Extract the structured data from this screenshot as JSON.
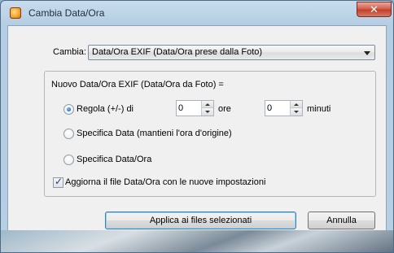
{
  "window": {
    "title": "Cambia Data/Ora",
    "close_glyph": "✕"
  },
  "change": {
    "label": "Cambia:",
    "selected": "Data/Ora EXIF (Data/Ora prese dalla Foto)"
  },
  "group": {
    "header": "Nuovo Data/Ora EXIF (Data/Ora da Foto) ="
  },
  "options": {
    "adjust": {
      "label": "Regola (+/-) di",
      "checked": true
    },
    "specify_date": {
      "label": "Specifica Data (mantieni l'ora d'origine)",
      "checked": false
    },
    "specify_datetime": {
      "label": "Specifica Data/Ora",
      "checked": false
    }
  },
  "adjust_hours": {
    "value": "0",
    "unit": "ore"
  },
  "adjust_minutes": {
    "value": "0",
    "unit": "minuti"
  },
  "update_file": {
    "label": "Aggiorna il file Data/Ora con le nuove impostazioni",
    "checked": true,
    "tick": "✓"
  },
  "buttons": {
    "apply": "Applica ai files selezionati",
    "cancel": "Annulla"
  }
}
